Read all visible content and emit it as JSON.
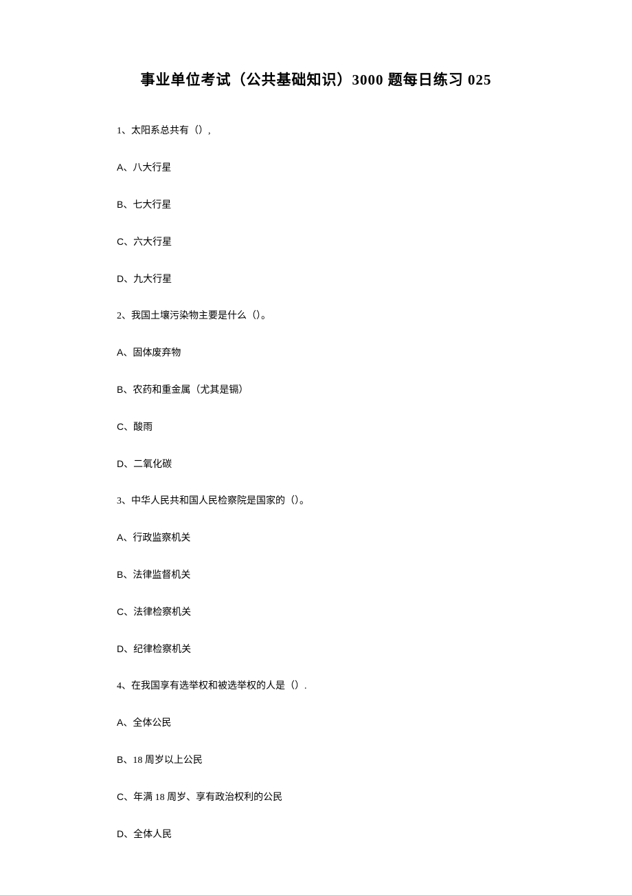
{
  "title": "事业单位考试（公共基础知识）3000 题每日练习 025",
  "questions": [
    {
      "text": "1、太阳系总共有（）,",
      "options": [
        {
          "label": "A",
          "text": "、八大行星"
        },
        {
          "label": "B",
          "text": "、七大行星"
        },
        {
          "label": "C",
          "text": "、六大行星"
        },
        {
          "label": "D",
          "text": "、九大行星"
        }
      ]
    },
    {
      "text": "2、我国土壤污染物主要是什么（）。",
      "options": [
        {
          "label": "A",
          "text": "、固体废弃物"
        },
        {
          "label": "B",
          "text": "、农药和重金属（尤其是镉）"
        },
        {
          "label": "C",
          "text": "、酸雨"
        },
        {
          "label": "D",
          "text": "、二氧化碳"
        }
      ]
    },
    {
      "text": "3、中华人民共和国人民检察院是国家的（）。",
      "options": [
        {
          "label": "A",
          "text": "、行政监察机关"
        },
        {
          "label": "B",
          "text": "、法律监督机关"
        },
        {
          "label": "C",
          "text": "、法律检察机关"
        },
        {
          "label": "D",
          "text": "、纪律检察机关"
        }
      ]
    },
    {
      "text": "4、在我国享有选举权和被选举权的人是（）.",
      "options": [
        {
          "label": "A",
          "text": "、全体公民"
        },
        {
          "label": "B",
          "text": "、18 周岁以上公民"
        },
        {
          "label": "C",
          "text": "、年满 18 周岁、享有政治权利的公民"
        },
        {
          "label": "D",
          "text": "、全体人民"
        }
      ]
    }
  ]
}
